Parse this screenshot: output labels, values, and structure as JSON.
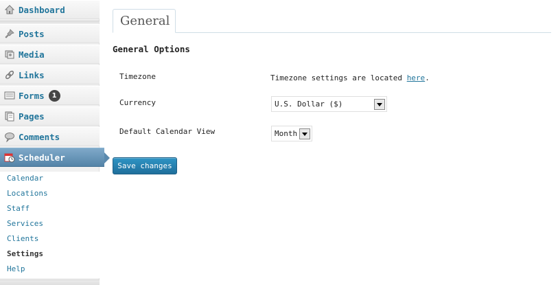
{
  "sidebar": {
    "menu": [
      {
        "label": "Dashboard",
        "icon": "dashboard-icon"
      },
      {
        "label": "Posts",
        "icon": "pushpin-icon"
      },
      {
        "label": "Media",
        "icon": "media-icon"
      },
      {
        "label": "Links",
        "icon": "link-icon"
      },
      {
        "label": "Forms",
        "icon": "form-icon",
        "badge": "1"
      },
      {
        "label": "Pages",
        "icon": "pages-icon"
      },
      {
        "label": "Comments",
        "icon": "comment-bubble-icon"
      },
      {
        "label": "Scheduler",
        "icon": "calendar-clock-icon"
      }
    ],
    "submenu": [
      "Calendar",
      "Locations",
      "Staff",
      "Services",
      "Clients",
      "Settings",
      "Help"
    ],
    "current_submenu": "Settings"
  },
  "main": {
    "tab_label": "General",
    "section_title": "General Options",
    "timezone": {
      "label": "Timezone",
      "text": "Timezone settings are located ",
      "link": "here",
      "suffix": "."
    },
    "currency": {
      "label": "Currency",
      "value": "U.S. Dollar ($)"
    },
    "calendar_view": {
      "label": "Default Calendar View",
      "value": "Month"
    },
    "save_label": "Save changes"
  },
  "colors": {
    "link": "#21759b",
    "active_menu": "#5a89ad",
    "button": "#2a86b6"
  }
}
